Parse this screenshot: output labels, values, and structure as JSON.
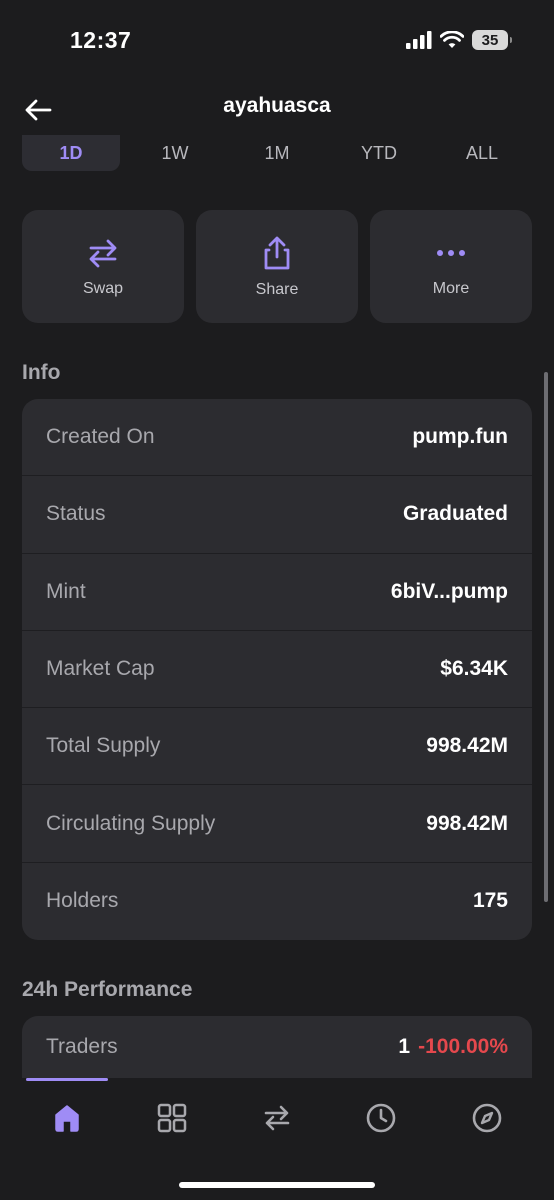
{
  "status_bar": {
    "time": "12:37",
    "battery": "35"
  },
  "header": {
    "title": "ayahuasca"
  },
  "range_tabs": [
    {
      "label": "1D",
      "active": true
    },
    {
      "label": "1W",
      "active": false
    },
    {
      "label": "1M",
      "active": false
    },
    {
      "label": "YTD",
      "active": false
    },
    {
      "label": "ALL",
      "active": false
    }
  ],
  "actions": [
    {
      "label": "Swap",
      "icon": "swap-icon"
    },
    {
      "label": "Share",
      "icon": "share-icon"
    },
    {
      "label": "More",
      "icon": "more-icon"
    }
  ],
  "info": {
    "title": "Info",
    "rows": [
      {
        "label": "Created On",
        "value": "pump.fun"
      },
      {
        "label": "Status",
        "value": "Graduated"
      },
      {
        "label": "Mint",
        "value": "6biV...pump"
      },
      {
        "label": "Market Cap",
        "value": "$6.34K"
      },
      {
        "label": "Total Supply",
        "value": "998.42M"
      },
      {
        "label": "Circulating Supply",
        "value": "998.42M"
      },
      {
        "label": "Holders",
        "value": "175"
      }
    ]
  },
  "performance": {
    "title": "24h Performance",
    "traders_label": "Traders",
    "traders_value": "1",
    "traders_change": "-100.00%"
  },
  "nav": {
    "items": [
      "home-icon",
      "grid-icon",
      "swap-icon",
      "history-icon",
      "explore-icon"
    ],
    "active_color": "#9f8cf5"
  },
  "colors": {
    "accent": "#9f8cf5",
    "negative": "#e5484d",
    "card": "#2c2c30",
    "background": "#1c1c1e"
  }
}
